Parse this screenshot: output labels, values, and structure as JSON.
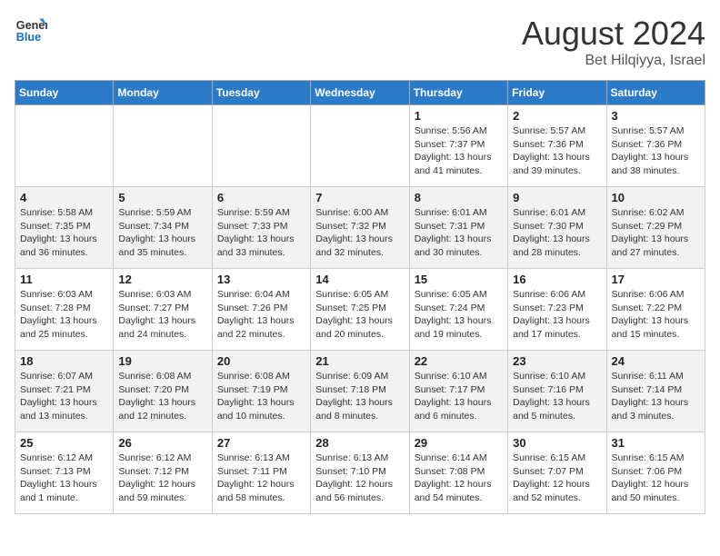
{
  "header": {
    "logo_line1": "General",
    "logo_line2": "Blue",
    "month": "August 2024",
    "location": "Bet Hilqiyya, Israel"
  },
  "weekdays": [
    "Sunday",
    "Monday",
    "Tuesday",
    "Wednesday",
    "Thursday",
    "Friday",
    "Saturday"
  ],
  "weeks": [
    [
      {
        "day": "",
        "info": ""
      },
      {
        "day": "",
        "info": ""
      },
      {
        "day": "",
        "info": ""
      },
      {
        "day": "",
        "info": ""
      },
      {
        "day": "1",
        "info": "Sunrise: 5:56 AM\nSunset: 7:37 PM\nDaylight: 13 hours\nand 41 minutes."
      },
      {
        "day": "2",
        "info": "Sunrise: 5:57 AM\nSunset: 7:36 PM\nDaylight: 13 hours\nand 39 minutes."
      },
      {
        "day": "3",
        "info": "Sunrise: 5:57 AM\nSunset: 7:36 PM\nDaylight: 13 hours\nand 38 minutes."
      }
    ],
    [
      {
        "day": "4",
        "info": "Sunrise: 5:58 AM\nSunset: 7:35 PM\nDaylight: 13 hours\nand 36 minutes."
      },
      {
        "day": "5",
        "info": "Sunrise: 5:59 AM\nSunset: 7:34 PM\nDaylight: 13 hours\nand 35 minutes."
      },
      {
        "day": "6",
        "info": "Sunrise: 5:59 AM\nSunset: 7:33 PM\nDaylight: 13 hours\nand 33 minutes."
      },
      {
        "day": "7",
        "info": "Sunrise: 6:00 AM\nSunset: 7:32 PM\nDaylight: 13 hours\nand 32 minutes."
      },
      {
        "day": "8",
        "info": "Sunrise: 6:01 AM\nSunset: 7:31 PM\nDaylight: 13 hours\nand 30 minutes."
      },
      {
        "day": "9",
        "info": "Sunrise: 6:01 AM\nSunset: 7:30 PM\nDaylight: 13 hours\nand 28 minutes."
      },
      {
        "day": "10",
        "info": "Sunrise: 6:02 AM\nSunset: 7:29 PM\nDaylight: 13 hours\nand 27 minutes."
      }
    ],
    [
      {
        "day": "11",
        "info": "Sunrise: 6:03 AM\nSunset: 7:28 PM\nDaylight: 13 hours\nand 25 minutes."
      },
      {
        "day": "12",
        "info": "Sunrise: 6:03 AM\nSunset: 7:27 PM\nDaylight: 13 hours\nand 24 minutes."
      },
      {
        "day": "13",
        "info": "Sunrise: 6:04 AM\nSunset: 7:26 PM\nDaylight: 13 hours\nand 22 minutes."
      },
      {
        "day": "14",
        "info": "Sunrise: 6:05 AM\nSunset: 7:25 PM\nDaylight: 13 hours\nand 20 minutes."
      },
      {
        "day": "15",
        "info": "Sunrise: 6:05 AM\nSunset: 7:24 PM\nDaylight: 13 hours\nand 19 minutes."
      },
      {
        "day": "16",
        "info": "Sunrise: 6:06 AM\nSunset: 7:23 PM\nDaylight: 13 hours\nand 17 minutes."
      },
      {
        "day": "17",
        "info": "Sunrise: 6:06 AM\nSunset: 7:22 PM\nDaylight: 13 hours\nand 15 minutes."
      }
    ],
    [
      {
        "day": "18",
        "info": "Sunrise: 6:07 AM\nSunset: 7:21 PM\nDaylight: 13 hours\nand 13 minutes."
      },
      {
        "day": "19",
        "info": "Sunrise: 6:08 AM\nSunset: 7:20 PM\nDaylight: 13 hours\nand 12 minutes."
      },
      {
        "day": "20",
        "info": "Sunrise: 6:08 AM\nSunset: 7:19 PM\nDaylight: 13 hours\nand 10 minutes."
      },
      {
        "day": "21",
        "info": "Sunrise: 6:09 AM\nSunset: 7:18 PM\nDaylight: 13 hours\nand 8 minutes."
      },
      {
        "day": "22",
        "info": "Sunrise: 6:10 AM\nSunset: 7:17 PM\nDaylight: 13 hours\nand 6 minutes."
      },
      {
        "day": "23",
        "info": "Sunrise: 6:10 AM\nSunset: 7:16 PM\nDaylight: 13 hours\nand 5 minutes."
      },
      {
        "day": "24",
        "info": "Sunrise: 6:11 AM\nSunset: 7:14 PM\nDaylight: 13 hours\nand 3 minutes."
      }
    ],
    [
      {
        "day": "25",
        "info": "Sunrise: 6:12 AM\nSunset: 7:13 PM\nDaylight: 13 hours\nand 1 minute."
      },
      {
        "day": "26",
        "info": "Sunrise: 6:12 AM\nSunset: 7:12 PM\nDaylight: 12 hours\nand 59 minutes."
      },
      {
        "day": "27",
        "info": "Sunrise: 6:13 AM\nSunset: 7:11 PM\nDaylight: 12 hours\nand 58 minutes."
      },
      {
        "day": "28",
        "info": "Sunrise: 6:13 AM\nSunset: 7:10 PM\nDaylight: 12 hours\nand 56 minutes."
      },
      {
        "day": "29",
        "info": "Sunrise: 6:14 AM\nSunset: 7:08 PM\nDaylight: 12 hours\nand 54 minutes."
      },
      {
        "day": "30",
        "info": "Sunrise: 6:15 AM\nSunset: 7:07 PM\nDaylight: 12 hours\nand 52 minutes."
      },
      {
        "day": "31",
        "info": "Sunrise: 6:15 AM\nSunset: 7:06 PM\nDaylight: 12 hours\nand 50 minutes."
      }
    ]
  ]
}
